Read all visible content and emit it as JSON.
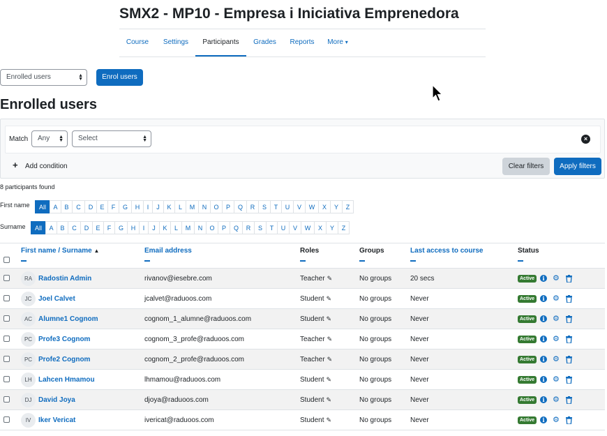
{
  "course": {
    "title": "SMX2 - MP10 - Empresa i Iniciativa Emprenedora",
    "tabs": [
      "Course",
      "Settings",
      "Participants",
      "Grades",
      "Reports",
      "More"
    ],
    "active_tab": "Participants"
  },
  "toolbar": {
    "view_select": "Enrolled users",
    "enrol_button": "Enrol users"
  },
  "page_heading": "Enrolled users",
  "filters": {
    "match_label": "Match",
    "match_value": "Any",
    "type_value": "Select",
    "add_condition": "Add condition",
    "clear_filters": "Clear filters",
    "apply_filters": "Apply filters"
  },
  "participants_found": "8 participants found",
  "initials": {
    "firstname_label": "First name",
    "surname_label": "Surname",
    "letters": [
      "All",
      "A",
      "B",
      "C",
      "D",
      "E",
      "F",
      "G",
      "H",
      "I",
      "J",
      "K",
      "L",
      "M",
      "N",
      "O",
      "P",
      "Q",
      "R",
      "S",
      "T",
      "U",
      "V",
      "W",
      "X",
      "Y",
      "Z"
    ],
    "active": "All"
  },
  "table": {
    "headers": {
      "name_first": "First name",
      "name_sep": " / ",
      "name_last": "Surname",
      "email": "Email address",
      "roles": "Roles",
      "groups": "Groups",
      "last_access": "Last access to course",
      "status": "Status"
    },
    "rows": [
      {
        "initials": "RA",
        "name": "Radostin Admin",
        "email": "rivanov@iesebre.com",
        "role": "Teacher",
        "groups": "No groups",
        "last_access": "20 secs",
        "status": "Active"
      },
      {
        "initials": "JC",
        "name": "Joel Calvet",
        "email": "jcalvet@raduoos.com",
        "role": "Student",
        "groups": "No groups",
        "last_access": "Never",
        "status": "Active"
      },
      {
        "initials": "AC",
        "name": "Alumne1 Cognom",
        "email": "cognom_1_alumne@raduoos.com",
        "role": "Student",
        "groups": "No groups",
        "last_access": "Never",
        "status": "Active"
      },
      {
        "initials": "PC",
        "name": "Profe3 Cognom",
        "email": "cognom_3_profe@raduoos.com",
        "role": "Teacher",
        "groups": "No groups",
        "last_access": "Never",
        "status": "Active"
      },
      {
        "initials": "PC",
        "name": "Profe2 Cognom",
        "email": "cognom_2_profe@raduoos.com",
        "role": "Teacher",
        "groups": "No groups",
        "last_access": "Never",
        "status": "Active"
      },
      {
        "initials": "LH",
        "name": "Lahcen Hmamou",
        "email": "lhmamou@raduoos.com",
        "role": "Student",
        "groups": "No groups",
        "last_access": "Never",
        "status": "Active"
      },
      {
        "initials": "DJ",
        "name": "David Joya",
        "email": "djoya@raduoos.com",
        "role": "Student",
        "groups": "No groups",
        "last_access": "Never",
        "status": "Active"
      },
      {
        "initials": "IV",
        "name": "Iker Vericat",
        "email": "ivericat@raduoos.com",
        "role": "Student",
        "groups": "No groups",
        "last_access": "Never",
        "status": "Active"
      }
    ]
  },
  "colors": {
    "primary": "#0f6cbf",
    "active_badge": "#357a32",
    "row_stripe": "#f2f2f2"
  },
  "icons": [
    "chevron-down-icon",
    "close-icon",
    "plus-icon",
    "sort-asc-icon",
    "pencil-icon",
    "info-icon",
    "gear-icon",
    "trash-icon",
    "mouse-pointer-icon"
  ]
}
